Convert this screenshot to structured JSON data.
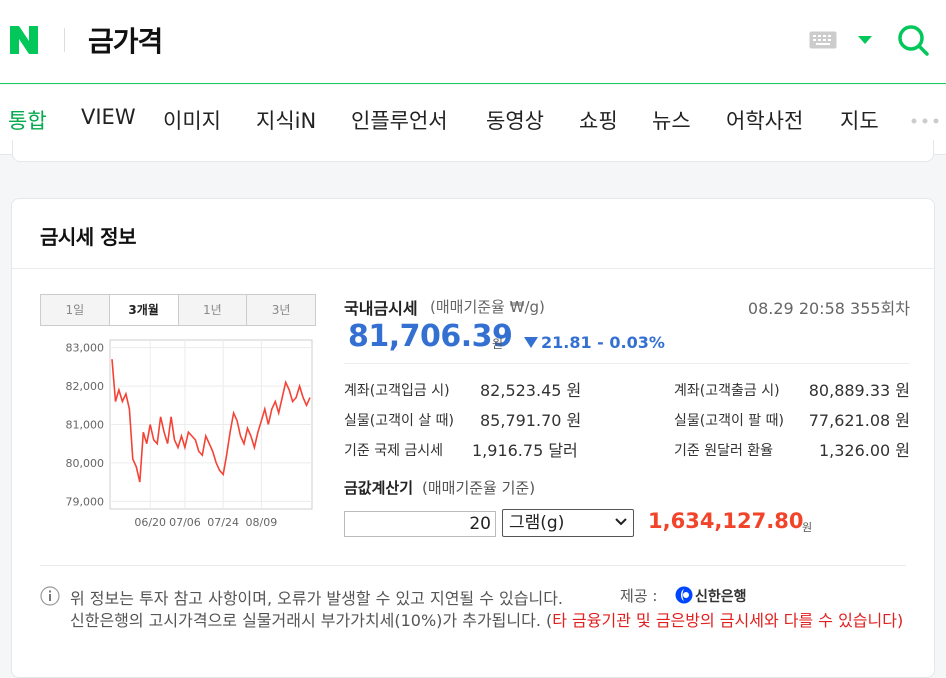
{
  "header": {
    "logo_letter": "N",
    "query": "금가격",
    "icons": [
      "keyboard-icon",
      "dropdown-arrow-icon",
      "search-icon"
    ],
    "brand_color": "#03c75a"
  },
  "tabs": [
    {
      "label": "통합",
      "active": true
    },
    {
      "label": "VIEW"
    },
    {
      "label": "이미지"
    },
    {
      "label": "지식iN"
    },
    {
      "label": "인플루언서"
    },
    {
      "label": "동영상"
    },
    {
      "label": "쇼핑"
    },
    {
      "label": "뉴스"
    },
    {
      "label": "어학사전"
    },
    {
      "label": "지도"
    }
  ],
  "card": {
    "title": "금시세 정보",
    "period_tabs": [
      "1일",
      "3개월",
      "1년",
      "3년"
    ],
    "active_period": "3개월"
  },
  "chart_data": {
    "type": "line",
    "x_ticks": [
      "06/20",
      "07/06",
      "07/24",
      "08/09"
    ],
    "y_ticks": [
      "83,000",
      "82,000",
      "81,000",
      "80,000",
      "79,000"
    ],
    "ylim": [
      78800,
      83200
    ],
    "grid": true,
    "color": "#f44336",
    "values": [
      82700,
      81600,
      81900,
      81600,
      81800,
      81400,
      80100,
      79900,
      79500,
      80800,
      80500,
      81000,
      80600,
      80500,
      81200,
      80800,
      80500,
      81200,
      80600,
      80400,
      80700,
      80400,
      80800,
      80700,
      80600,
      80300,
      80200,
      80700,
      80500,
      80300,
      80000,
      79800,
      79700,
      80200,
      80800,
      81300,
      81100,
      80700,
      80500,
      80900,
      80700,
      80400,
      80800,
      81100,
      81400,
      81000,
      81400,
      81600,
      81300,
      81700,
      82100,
      81900,
      81600,
      81700,
      82000,
      81700,
      81500,
      81700
    ]
  },
  "domestic": {
    "title": "국내금시세",
    "basis": "(매매기준율 ₩/g)",
    "timestamp": "08.29 20:58 355회차",
    "price": "81,706.39",
    "price_unit": "원",
    "change": "21.81 - 0.03%",
    "direction": "down"
  },
  "rows": {
    "left": [
      {
        "label": "계좌(고객입금 시)",
        "value": "82,523.45 원"
      },
      {
        "label": "실물(고객이 살 때)",
        "value": "85,791.70 원"
      },
      {
        "label": "기준 국제 금시세",
        "value": "1,916.75 달러"
      }
    ],
    "right": [
      {
        "label": "계좌(고객출금 시)",
        "value": "80,889.33 원"
      },
      {
        "label": "실물(고객이 팔 때)",
        "value": "77,621.08 원"
      },
      {
        "label": "기준 원달러 환율",
        "value": "1,326.00 원"
      }
    ]
  },
  "calculator": {
    "title": "금값계산기",
    "basis": "(매매기준율 기준)",
    "amount": "20",
    "unit_selected": "그램(g)",
    "result": "1,634,127.80",
    "result_unit": "원"
  },
  "notice": {
    "line1": "위 정보는 투자 참고 사항이며, 오류가 발생할 수 있고 지연될 수 있습니다.",
    "provider_label": "제공 :",
    "provider_name": "신한은행",
    "line2": "신한은행의 고시가격으로 실물거래시 부가가치세(10%)가 추가됩니다. (",
    "line2_red": "타 금융기관 및 금은방의 금시세와 다를 수 있습니다",
    "line2_end": ")"
  }
}
